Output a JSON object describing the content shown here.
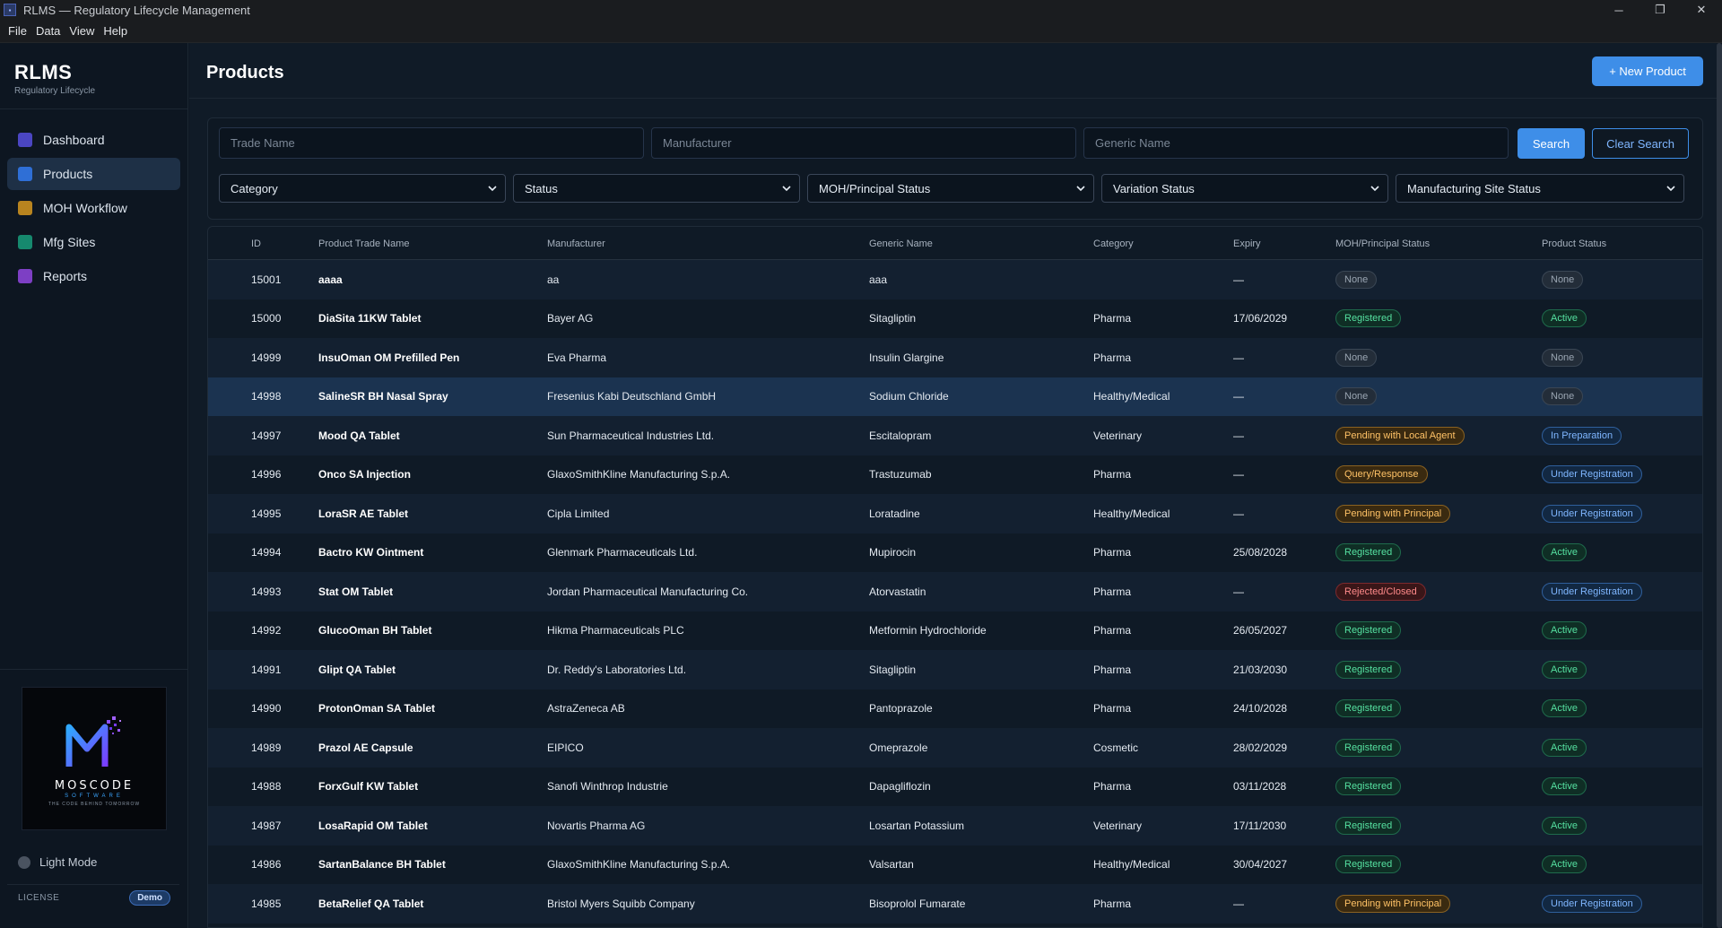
{
  "window": {
    "title": "RLMS — Regulatory Lifecycle Management",
    "icons": [
      "minimize-icon",
      "restore-icon",
      "close-icon"
    ]
  },
  "menu": [
    "File",
    "Data",
    "View",
    "Help"
  ],
  "brand": {
    "title": "RLMS",
    "subtitle": "Regulatory Lifecycle"
  },
  "nav": [
    {
      "label": "Dashboard",
      "color": "#4b46c2"
    },
    {
      "label": "Products",
      "color": "#2f6fd6",
      "active": true
    },
    {
      "label": "MOH Workflow",
      "color": "#b8841f"
    },
    {
      "label": "Mfg Sites",
      "color": "#16896e"
    },
    {
      "label": "Reports",
      "color": "#7d3fc4"
    }
  ],
  "logo": {
    "name": "MOSCODE",
    "sub": "SOFTWARE",
    "tagline": "THE CODE BEHIND TOMORROW"
  },
  "light_mode_label": "Light Mode",
  "license": {
    "label": "LICENSE",
    "badge": "Demo"
  },
  "page": {
    "title": "Products",
    "new_button": "+ New Product"
  },
  "filters": {
    "trade_name_placeholder": "Trade Name",
    "manufacturer_placeholder": "Manufacturer",
    "generic_name_placeholder": "Generic Name",
    "search_label": "Search",
    "clear_label": "Clear Search",
    "selects": [
      "Category",
      "Status",
      "MOH/Principal Status",
      "Variation Status",
      "Manufacturing Site Status"
    ]
  },
  "table": {
    "headers": [
      "ID",
      "Product Trade Name",
      "Manufacturer",
      "Generic Name",
      "Category",
      "Expiry",
      "MOH/Principal Status",
      "Product Status"
    ],
    "selected_id": "14998",
    "rows": [
      {
        "id": "15001",
        "name": "aaaa",
        "manufacturer": "aa",
        "generic": "aaa",
        "category": "",
        "expiry": "—",
        "moh": "None",
        "moh_style": "none",
        "status": "None",
        "status_style": "none"
      },
      {
        "id": "15000",
        "name": "DiaSita 11KW Tablet",
        "manufacturer": "Bayer AG",
        "generic": "Sitagliptin",
        "category": "Pharma",
        "expiry": "17/06/2029",
        "moh": "Registered",
        "moh_style": "registered",
        "status": "Active",
        "status_style": "active"
      },
      {
        "id": "14999",
        "name": "InsuOman OM Prefilled Pen",
        "manufacturer": "Eva Pharma",
        "generic": "Insulin Glargine",
        "category": "Pharma",
        "expiry": "—",
        "moh": "None",
        "moh_style": "none",
        "status": "None",
        "status_style": "none"
      },
      {
        "id": "14998",
        "name": "SalineSR BH Nasal Spray",
        "manufacturer": "Fresenius Kabi Deutschland GmbH",
        "generic": "Sodium Chloride",
        "category": "Healthy/Medical",
        "expiry": "—",
        "moh": "None",
        "moh_style": "none",
        "status": "None",
        "status_style": "none"
      },
      {
        "id": "14997",
        "name": "Mood QA Tablet",
        "manufacturer": "Sun Pharmaceutical Industries Ltd.",
        "generic": "Escitalopram",
        "category": "Veterinary",
        "expiry": "—",
        "moh": "Pending with Local Agent",
        "moh_style": "amber",
        "status": "In Preparation",
        "status_style": "blue"
      },
      {
        "id": "14996",
        "name": "Onco SA Injection",
        "manufacturer": "GlaxoSmithKline Manufacturing S.p.A.",
        "generic": "Trastuzumab",
        "category": "Pharma",
        "expiry": "—",
        "moh": "Query/Response",
        "moh_style": "amber",
        "status": "Under Registration",
        "status_style": "blue"
      },
      {
        "id": "14995",
        "name": "LoraSR AE Tablet",
        "manufacturer": "Cipla Limited",
        "generic": "Loratadine",
        "category": "Healthy/Medical",
        "expiry": "—",
        "moh": "Pending with Principal",
        "moh_style": "amber",
        "status": "Under Registration",
        "status_style": "blue"
      },
      {
        "id": "14994",
        "name": "Bactro KW Ointment",
        "manufacturer": "Glenmark Pharmaceuticals Ltd.",
        "generic": "Mupirocin",
        "category": "Pharma",
        "expiry": "25/08/2028",
        "moh": "Registered",
        "moh_style": "registered",
        "status": "Active",
        "status_style": "active"
      },
      {
        "id": "14993",
        "name": "Stat OM Tablet",
        "manufacturer": "Jordan Pharmaceutical Manufacturing Co.",
        "generic": "Atorvastatin",
        "category": "Pharma",
        "expiry": "—",
        "moh": "Rejected/Closed",
        "moh_style": "red",
        "status": "Under Registration",
        "status_style": "blue"
      },
      {
        "id": "14992",
        "name": "GlucoOman BH Tablet",
        "manufacturer": "Hikma Pharmaceuticals PLC",
        "generic": "Metformin Hydrochloride",
        "category": "Pharma",
        "expiry": "26/05/2027",
        "moh": "Registered",
        "moh_style": "registered",
        "status": "Active",
        "status_style": "active"
      },
      {
        "id": "14991",
        "name": "Glipt QA Tablet",
        "manufacturer": "Dr. Reddy's Laboratories Ltd.",
        "generic": "Sitagliptin",
        "category": "Pharma",
        "expiry": "21/03/2030",
        "moh": "Registered",
        "moh_style": "registered",
        "status": "Active",
        "status_style": "active"
      },
      {
        "id": "14990",
        "name": "ProtonOman SA Tablet",
        "manufacturer": "AstraZeneca AB",
        "generic": "Pantoprazole",
        "category": "Pharma",
        "expiry": "24/10/2028",
        "moh": "Registered",
        "moh_style": "registered",
        "status": "Active",
        "status_style": "active"
      },
      {
        "id": "14989",
        "name": "Prazol AE Capsule",
        "manufacturer": "EIPICO",
        "generic": "Omeprazole",
        "category": "Cosmetic",
        "expiry": "28/02/2029",
        "moh": "Registered",
        "moh_style": "registered",
        "status": "Active",
        "status_style": "active"
      },
      {
        "id": "14988",
        "name": "ForxGulf KW Tablet",
        "manufacturer": "Sanofi Winthrop Industrie",
        "generic": "Dapagliflozin",
        "category": "Pharma",
        "expiry": "03/11/2028",
        "moh": "Registered",
        "moh_style": "registered",
        "status": "Active",
        "status_style": "active"
      },
      {
        "id": "14987",
        "name": "LosaRapid OM Tablet",
        "manufacturer": "Novartis Pharma AG",
        "generic": "Losartan Potassium",
        "category": "Veterinary",
        "expiry": "17/11/2030",
        "moh": "Registered",
        "moh_style": "registered",
        "status": "Active",
        "status_style": "active"
      },
      {
        "id": "14986",
        "name": "SartanBalance BH Tablet",
        "manufacturer": "GlaxoSmithKline Manufacturing S.p.A.",
        "generic": "Valsartan",
        "category": "Healthy/Medical",
        "expiry": "30/04/2027",
        "moh": "Registered",
        "moh_style": "registered",
        "status": "Active",
        "status_style": "active"
      },
      {
        "id": "14985",
        "name": "BetaRelief QA Tablet",
        "manufacturer": "Bristol Myers Squibb Company",
        "generic": "Bisoprolol Fumarate",
        "category": "Pharma",
        "expiry": "—",
        "moh": "Pending with Principal",
        "moh_style": "amber",
        "status": "Under Registration",
        "status_style": "blue"
      }
    ]
  }
}
